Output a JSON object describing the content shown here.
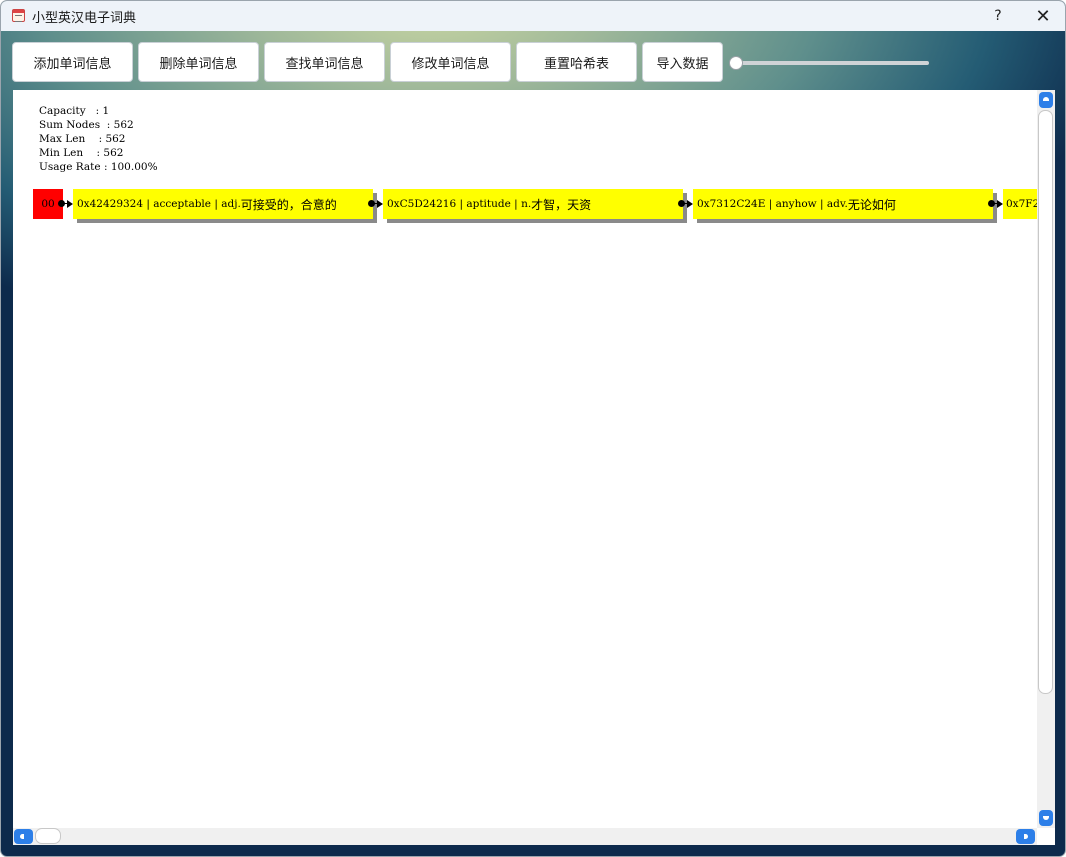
{
  "window": {
    "title": "小型英汉电子词典",
    "help_label": "?",
    "close_label": "✕",
    "app_icon": "dictionary-calendar-icon"
  },
  "toolbar": {
    "add_label": "添加单词信息",
    "delete_label": "删除单词信息",
    "find_label": "查找单词信息",
    "modify_label": "修改单词信息",
    "reset_label": "重置哈希表",
    "import_label": "导入数据",
    "slider_value": 0
  },
  "stats": {
    "capacity": "Capacity   : 1",
    "sum_nodes": "Sum Nodes  : 562",
    "max_len": "Max Len    : 562",
    "min_len": "Min Len    : 562",
    "usage_rate": "Usage Rate : 100.00%"
  },
  "hash_table": {
    "bucket_label": "00",
    "nodes": [
      {
        "hash": "0x42429324",
        "word": "acceptable",
        "pos": "adj.",
        "meaning": "可接受的，合意的"
      },
      {
        "hash": "0xC5D24216",
        "word": "aptitude",
        "pos": "n.",
        "meaning": "才智，天资"
      },
      {
        "hash": "0x7312C24E",
        "word": "anyhow",
        "pos": "adv.",
        "meaning": "无论如何"
      },
      {
        "hash_prefix": "0x7F2"
      }
    ]
  },
  "colors": {
    "bucket": "#ff0000",
    "node": "#ffff00",
    "node_shadow": "#8a8a8a",
    "scroll_button": "#2d7fe8"
  }
}
